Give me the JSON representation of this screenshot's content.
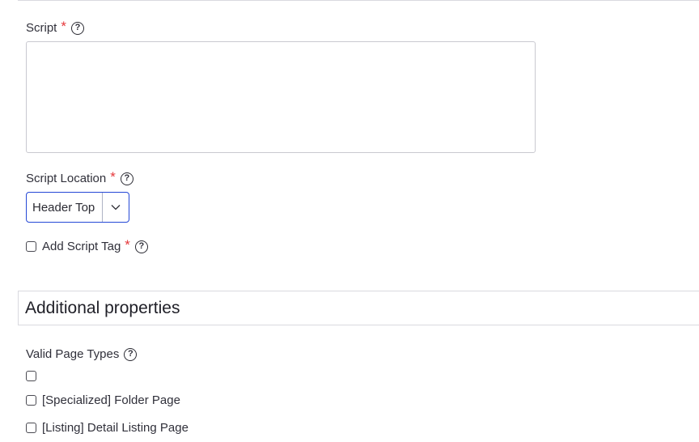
{
  "script_field": {
    "label": "Script",
    "required_mark": "*",
    "help_glyph": "?",
    "value": ""
  },
  "script_location": {
    "label": "Script Location",
    "required_mark": "*",
    "help_glyph": "?",
    "selected": "Header Top",
    "accent_color": "#2548d6"
  },
  "add_script_tag": {
    "label": "Add Script Tag",
    "required_mark": "*",
    "help_glyph": "?",
    "checked": false
  },
  "section": {
    "title": "Additional properties"
  },
  "valid_page_types": {
    "label": "Valid Page Types",
    "help_glyph": "?",
    "options": [
      {
        "label": "",
        "checked": false
      },
      {
        "label": "[Specialized] Folder Page",
        "checked": false
      },
      {
        "label": "[Listing] Detail Listing Page",
        "checked": false
      }
    ]
  },
  "colors": {
    "required": "#e5383b",
    "border": "#d9d9df"
  }
}
